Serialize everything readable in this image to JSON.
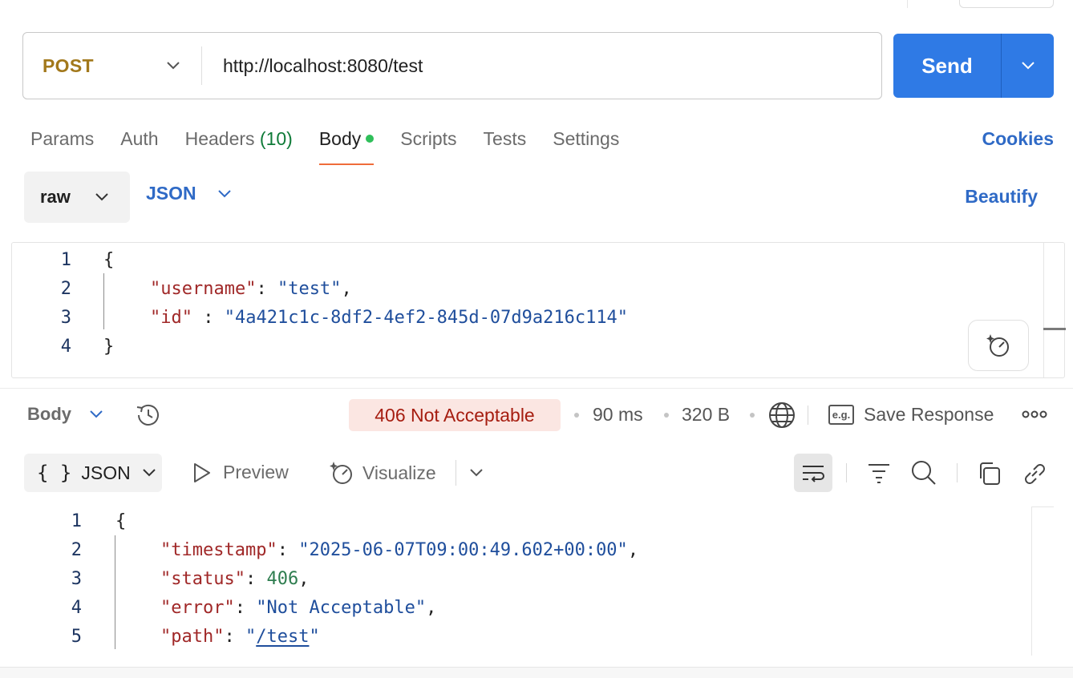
{
  "request": {
    "method": "POST",
    "url": "http://localhost:8080/test",
    "send_label": "Send"
  },
  "tabs": [
    {
      "label": "Params"
    },
    {
      "label": "Auth"
    },
    {
      "label": "Headers",
      "count": "(10)"
    },
    {
      "label": "Body",
      "active": true
    },
    {
      "label": "Scripts"
    },
    {
      "label": "Tests"
    },
    {
      "label": "Settings"
    }
  ],
  "cookies_label": "Cookies",
  "body_mode": {
    "type": "raw",
    "language": "JSON",
    "beautify_label": "Beautify"
  },
  "request_body": {
    "line_numbers": [
      "1",
      "2",
      "3",
      "4"
    ],
    "open_brace": "{",
    "close_brace": "}",
    "username_key": "\"username\"",
    "username_value": "\"test\"",
    "id_key": "\"id\"",
    "id_value": "\"4a421c1c-8df2-4ef2-845d-07d9a216c114\""
  },
  "response": {
    "view_label": "Body",
    "status": "406 Not Acceptable",
    "time": "90 ms",
    "size": "320 B",
    "eg_label": "e.g.",
    "save_label": "Save Response",
    "format_label": "JSON",
    "format_braces": "{ }",
    "preview_label": "Preview",
    "visualize_label": "Visualize",
    "line_numbers": [
      "1",
      "2",
      "3",
      "4",
      "5"
    ],
    "open_brace": "{",
    "timestamp_key": "\"timestamp\"",
    "timestamp_value": "\"2025-06-07T09:00:49.602+00:00\"",
    "status_key": "\"status\"",
    "status_value": "406",
    "error_key": "\"error\"",
    "error_value": "\"Not Acceptable\"",
    "path_key": "\"path\"",
    "path_value": "/test"
  },
  "colors": {
    "send_button": "#2f7ae5",
    "method": "#a2781b",
    "link": "#2f6ac6",
    "active_tab_underline": "#ef6c3a",
    "status_badge_bg": "#fbe6e2",
    "status_badge_text": "#a61d10",
    "json_key": "#a02828",
    "json_string": "#1f4e9c",
    "json_number": "#2e7d4f"
  }
}
